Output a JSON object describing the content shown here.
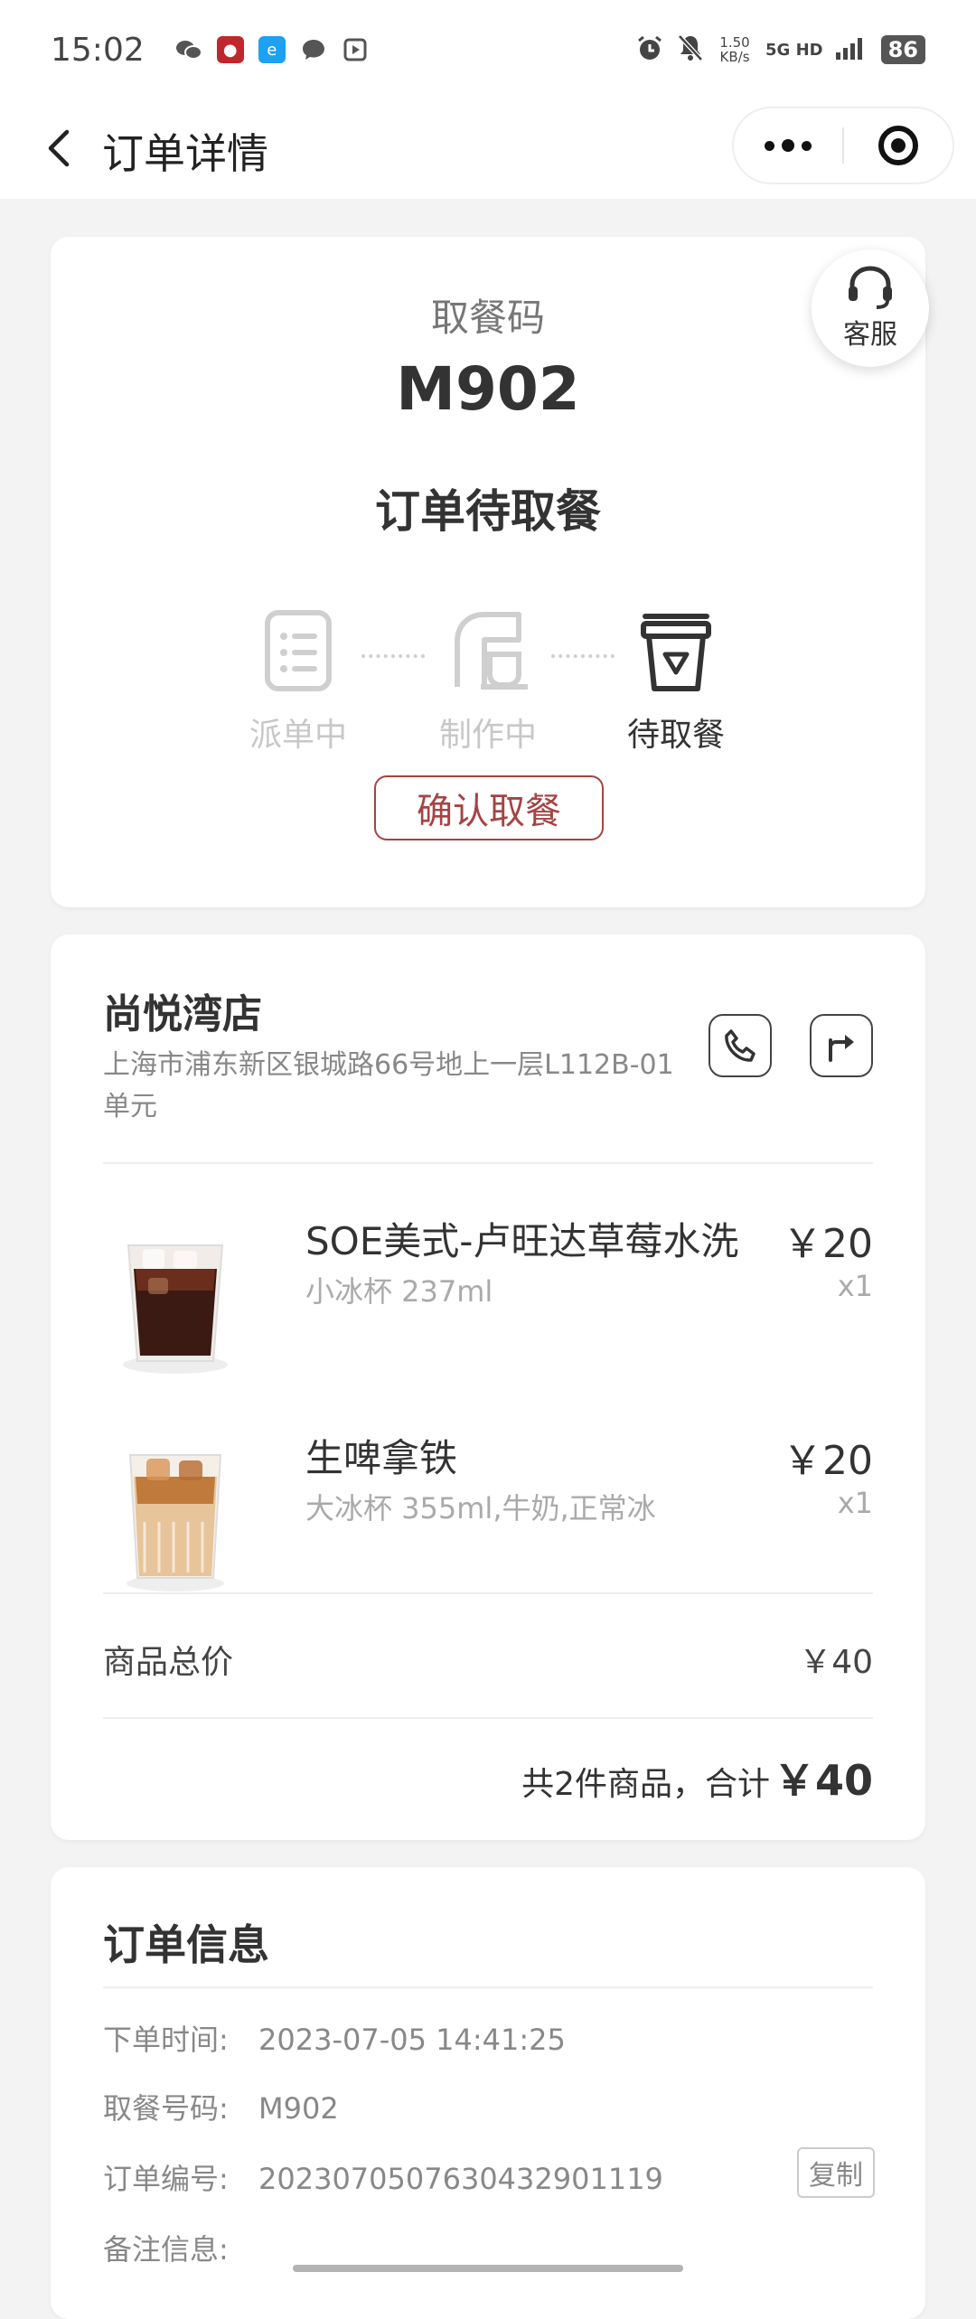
{
  "status_bar": {
    "time": "15:02",
    "network_speed": "1.50 KB/s",
    "network": "5G HD",
    "battery": "86"
  },
  "nav": {
    "title": "订单详情"
  },
  "pickup": {
    "label": "取餐码",
    "code": "M902",
    "status": "订单待取餐",
    "service_label": "客服",
    "steps": [
      {
        "label": "派单中",
        "icon": "list-icon",
        "active": false
      },
      {
        "label": "制作中",
        "icon": "coffee-machine-icon",
        "active": false
      },
      {
        "label": "待取餐",
        "icon": "cup-icon",
        "active": true
      }
    ],
    "confirm_label": "确认取餐",
    "accent_color": "#a64343"
  },
  "store": {
    "name": "尚悦湾店",
    "address": "上海市浦东新区银城路66号地上一层L112B-01单元",
    "items": [
      {
        "name": "SOE美式-卢旺达草莓水洗",
        "spec": "小冰杯 237ml",
        "price": "￥20",
        "qty": "x1"
      },
      {
        "name": "生啤拿铁",
        "spec": "大冰杯 355ml,牛奶,正常冰",
        "price": "￥20",
        "qty": "x1"
      }
    ],
    "subtotal_label": "商品总价",
    "subtotal_value": "￥40",
    "total_prefix": "共2件商品，合计",
    "total_amount": "￥40"
  },
  "order_info": {
    "title": "订单信息",
    "rows": [
      {
        "key": "下单时间:",
        "value": "2023-07-05 14:41:25"
      },
      {
        "key": "取餐号码:",
        "value": "M902"
      },
      {
        "key": "订单编号:",
        "value": "2023070507630432901119"
      },
      {
        "key": "备注信息:",
        "value": ""
      }
    ],
    "copy_label": "复制"
  }
}
